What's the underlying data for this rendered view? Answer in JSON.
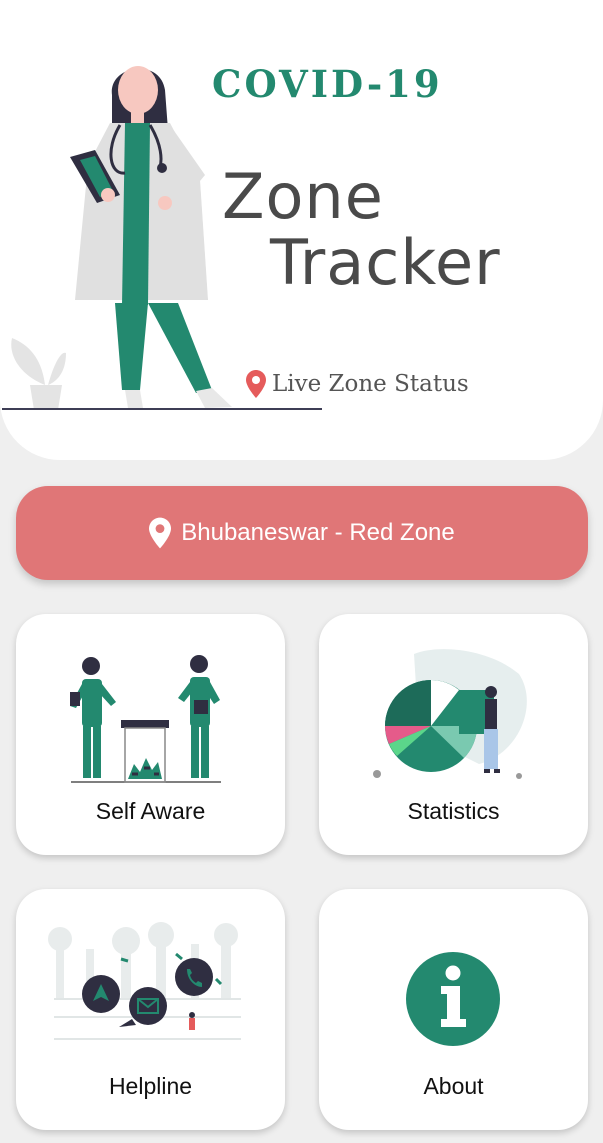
{
  "header": {
    "title_line1": "COVID-19",
    "title_line2": "Zone",
    "title_line3": "Tracker",
    "live_status": "Live Zone Status",
    "live_status_icon": "map-pin-icon"
  },
  "zone_banner": {
    "text": "Bhubaneswar - Red Zone",
    "icon": "map-pin-icon",
    "color": "#e07677"
  },
  "cards": [
    {
      "label": "Self Aware",
      "icon": "doctors-illustration"
    },
    {
      "label": "Statistics",
      "icon": "pie-chart-illustration"
    },
    {
      "label": "Helpline",
      "icon": "contact-illustration"
    },
    {
      "label": "About",
      "icon": "info-icon"
    }
  ],
  "colors": {
    "accent": "#23896f",
    "banner": "#e07677",
    "background": "#efefef"
  }
}
